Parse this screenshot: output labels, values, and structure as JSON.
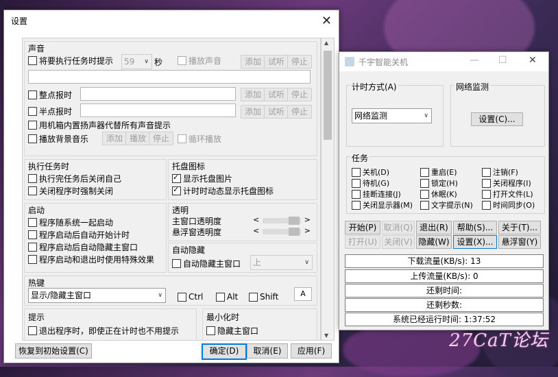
{
  "watermark": "27CaT论坛",
  "settings": {
    "title": "设置",
    "sound": {
      "title": "声音",
      "preexec_label": "将要执行任务时提示",
      "preexec_value": "59",
      "seconds": "秒",
      "play_sound": "播放声音",
      "add": "添加",
      "listen": "试听",
      "stop": "停止",
      "hourly": "整点报时",
      "half_hourly": "半点报时",
      "pc_speaker": "用机箱内置扬声器代替所有声音提示",
      "bg_music": "播放背景音乐",
      "play": "播放",
      "loop": "循环播放"
    },
    "task": {
      "title": "执行任务时",
      "close_after": "执行完任务后关闭自己",
      "force_close": "关闭程序时强制关闭"
    },
    "tray": {
      "title": "托盘图标",
      "show_image": "显示托盘图片",
      "dynamic_icon": "计时时动态显示托盘图标"
    },
    "startup": {
      "title": "启动",
      "with_system": "程序随系统一起启动",
      "auto_start": "程序启动后自动开始计时",
      "auto_hide": "程序启动后自动隐藏主窗口",
      "special_effect": "程序启动和退出时使用特殊效果"
    },
    "transparency": {
      "title": "透明",
      "main": "主窗口透明度",
      "float": "悬浮窗透明度",
      "main_level": 1.0,
      "float_level": 1.0
    },
    "autohide": {
      "title": "自动隐藏",
      "main": "自动隐藏主窗口",
      "position": "上"
    },
    "hotkey": {
      "title": "热键",
      "action": "显示/隐藏主窗口",
      "ctrl": "Ctrl",
      "alt": "Alt",
      "shift": "Shift",
      "key": "A"
    },
    "prompt": {
      "title": "提示",
      "exit_noprompt": "退出程序时，即使正在计时也不用提示"
    },
    "minimize": {
      "title": "最小化时",
      "hide_main": "隐藏主窗口"
    },
    "footer": {
      "reset": "恢复到初始设置(C)",
      "ok": "确定(D)",
      "cancel": "取消(E)",
      "apply": "应用(F)"
    }
  },
  "app": {
    "title": "千宇智能关机",
    "timing": {
      "label": "计时方式(A)",
      "value": "网络监测"
    },
    "netmon": {
      "label": "网络监测",
      "settings_btn": "设置(C)..."
    },
    "tasks": {
      "label": "任务",
      "items": [
        "关机(D)",
        "重启(E)",
        "注销(F)",
        "待机(G)",
        "锁定(H)",
        "关闭程序(I)",
        "挂断连接(J)",
        "休眠(K)",
        "打开文件(L)",
        "关闭显示器(M)",
        "文字提示(N)",
        "时间同步(O)"
      ]
    },
    "buttons_row1": [
      "开始(P)",
      "取消(Q)",
      "退出(R)",
      "帮助(S)...",
      "关于(T)..."
    ],
    "buttons_row2": [
      "打开(U)",
      "关闭(V)",
      "隐藏(W)",
      "设置(X)...",
      "悬浮窗(Y)"
    ],
    "status": {
      "download": "下载流量(KB/s): 13",
      "upload": "上传流量(KB/s): 0",
      "remaining_time": "还剩时间:",
      "remaining_seconds": "还剩秒数:",
      "uptime": "系统已经运行时间: 1:37:52"
    }
  }
}
